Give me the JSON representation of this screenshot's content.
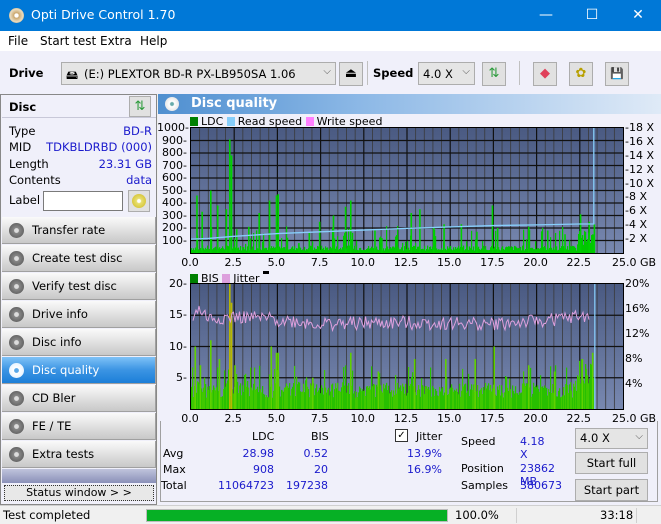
{
  "window": {
    "title": "Opti Drive Control 1.70",
    "minimize": "—",
    "maximize": "☐",
    "close": "✕"
  },
  "menu": [
    "File",
    "Start test",
    "Extra",
    "Help"
  ],
  "toolbar": {
    "drive_label": "Drive",
    "drive_value": "(E:)  PLEXTOR BD-R  PX-LB950SA 1.06",
    "speed_label": "Speed",
    "speed_value": "4.0 X",
    "eject_icon": "⏏",
    "refresh_icon": "⇅",
    "erase_icon": "◆",
    "burn_icon": "✿",
    "save_icon": "💾"
  },
  "disc": {
    "header": "Disc",
    "rows": [
      {
        "key": "Type",
        "value": "BD-R"
      },
      {
        "key": "MID",
        "value": "TDKBLDRBD (000)"
      },
      {
        "key": "Length",
        "value": "23.31 GB"
      },
      {
        "key": "Contents",
        "value": "data"
      }
    ],
    "label_key": "Label",
    "label_value": ""
  },
  "nav": [
    {
      "label": "Transfer rate",
      "active": false
    },
    {
      "label": "Create test disc",
      "active": false
    },
    {
      "label": "Verify test disc",
      "active": false
    },
    {
      "label": "Drive info",
      "active": false
    },
    {
      "label": "Disc info",
      "active": false
    },
    {
      "label": "Disc quality",
      "active": true
    },
    {
      "label": "CD Bler",
      "active": false
    },
    {
      "label": "FE / TE",
      "active": false
    },
    {
      "label": "Extra tests",
      "active": false
    }
  ],
  "status_window_btn": "Status window > >",
  "panel_title": "Disc quality",
  "chart_data": [
    {
      "type": "bar",
      "title": "LDC / Read speed",
      "legend": [
        {
          "name": "LDC",
          "color": "#008000"
        },
        {
          "name": "Read speed",
          "color": "#87cefa"
        },
        {
          "name": "Write speed",
          "color": "#ff80ff"
        }
      ],
      "xlabel": "GB",
      "xlim": [
        0,
        25
      ],
      "ylim": [
        0,
        1000
      ],
      "y2lim": [
        0,
        18
      ],
      "x_ticks": [
        "0.0",
        "2.5",
        "5.0",
        "7.5",
        "10.0",
        "12.5",
        "15.0",
        "17.5",
        "20.0",
        "22.5",
        "25.0 GB"
      ],
      "y_ticks": [
        "100",
        "200",
        "300",
        "400",
        "500",
        "600",
        "700",
        "800",
        "900",
        "1000"
      ],
      "y2_ticks": [
        "2 X",
        "4 X",
        "6 X",
        "8 X",
        "10 X",
        "12 X",
        "14 X",
        "16 X",
        "18 X"
      ],
      "grid": true,
      "data_end_gb": 23.31,
      "ldc_peaks": [
        [
          0.3,
          460
        ],
        [
          0.6,
          330
        ],
        [
          1.1,
          500
        ],
        [
          1.5,
          380
        ],
        [
          2.0,
          350
        ],
        [
          2.2,
          908
        ],
        [
          2.3,
          780
        ],
        [
          2.6,
          190
        ],
        [
          3.3,
          210
        ],
        [
          3.9,
          320
        ],
        [
          4.5,
          420
        ],
        [
          4.9,
          460
        ],
        [
          5.0,
          470
        ],
        [
          6.2,
          80
        ],
        [
          6.8,
          160
        ],
        [
          7.4,
          250
        ],
        [
          8.2,
          300
        ],
        [
          8.9,
          370
        ],
        [
          9.2,
          420
        ],
        [
          10.6,
          180
        ],
        [
          11.0,
          120
        ],
        [
          12.7,
          320
        ],
        [
          13.2,
          350
        ],
        [
          14.0,
          200
        ],
        [
          14.6,
          230
        ],
        [
          15.6,
          230
        ],
        [
          16.5,
          170
        ],
        [
          17.4,
          380
        ],
        [
          17.7,
          200
        ],
        [
          19.5,
          210
        ],
        [
          20.6,
          180
        ],
        [
          21.6,
          150
        ],
        [
          22.5,
          310
        ],
        [
          23.0,
          250
        ],
        [
          23.3,
          230
        ]
      ],
      "ldc_baseline": 40,
      "read_speed": [
        [
          0,
          2.0
        ],
        [
          1,
          2.1
        ],
        [
          2.5,
          2.4
        ],
        [
          5,
          2.8
        ],
        [
          7.5,
          3.05
        ],
        [
          10,
          3.3
        ],
        [
          12.5,
          3.55
        ],
        [
          15,
          3.75
        ],
        [
          17.5,
          3.95
        ],
        [
          20,
          4.05
        ],
        [
          22.5,
          4.18
        ],
        [
          23.31,
          4.18
        ],
        [
          23.31,
          18
        ]
      ]
    },
    {
      "type": "bar",
      "title": "BIS / Jitter",
      "legend": [
        {
          "name": "BIS",
          "color": "#008000"
        },
        {
          "name": "Jitter",
          "color": "#dda0dd"
        }
      ],
      "xlabel": "GB",
      "xlim": [
        0,
        25
      ],
      "ylim": [
        0,
        20
      ],
      "y2lim": [
        0,
        20
      ],
      "x_ticks": [
        "0.0",
        "2.5",
        "5.0",
        "7.5",
        "10.0",
        "12.5",
        "15.0",
        "17.5",
        "20.0",
        "22.5",
        "25.0 GB"
      ],
      "y_ticks": [
        "5",
        "10",
        "15",
        "20"
      ],
      "y2_ticks": [
        "4%",
        "8%",
        "12%",
        "16%",
        "20%"
      ],
      "grid": true,
      "data_end_gb": 23.31,
      "bis_peaks": [
        [
          0.2,
          10
        ],
        [
          0.5,
          7
        ],
        [
          1.1,
          11
        ],
        [
          1.6,
          8
        ],
        [
          2.2,
          20
        ],
        [
          2.3,
          17
        ],
        [
          2.5,
          7
        ],
        [
          4.6,
          10
        ],
        [
          4.9,
          9
        ],
        [
          5.0,
          9
        ],
        [
          7.0,
          5
        ],
        [
          9.2,
          9
        ],
        [
          10.8,
          6
        ],
        [
          12.9,
          8
        ],
        [
          14.7,
          8
        ],
        [
          16.4,
          8
        ],
        [
          17.5,
          10
        ],
        [
          19.5,
          7
        ],
        [
          21.0,
          6
        ],
        [
          22.6,
          8
        ],
        [
          23.2,
          9
        ]
      ],
      "bis_baseline": 3,
      "jitter_pct": [
        [
          0,
          14.5
        ],
        [
          0.5,
          16.0
        ],
        [
          1.0,
          14.5
        ],
        [
          2.5,
          14.7
        ],
        [
          5,
          14.3
        ],
        [
          7.5,
          13.6
        ],
        [
          10,
          13.7
        ],
        [
          12.5,
          13.8
        ],
        [
          15,
          13.7
        ],
        [
          17.5,
          13.6
        ],
        [
          20,
          14.0
        ],
        [
          22.5,
          14.8
        ],
        [
          23.31,
          14.8
        ]
      ]
    }
  ],
  "stats": {
    "col_ldc": "LDC",
    "col_bis": "BIS",
    "jitter_label": "Jitter",
    "jitter_checked": true,
    "rows": [
      {
        "label": "Avg",
        "ldc": "28.98",
        "bis": "0.52",
        "jitter": "13.9%"
      },
      {
        "label": "Max",
        "ldc": "908",
        "bis": "20",
        "jitter": "16.9%"
      },
      {
        "label": "Total",
        "ldc": "11064723",
        "bis": "197238",
        "jitter": ""
      }
    ],
    "speed_label": "Speed",
    "speed_value": "4.18 X",
    "position_label": "Position",
    "position_value": "23862 MB",
    "samples_label": "Samples",
    "samples_value": "380673",
    "speed_select": "4.0 X",
    "start_full": "Start full",
    "start_part": "Start part"
  },
  "statusbar": {
    "text": "Test completed",
    "progress": 100.0,
    "progress_text": "100.0%",
    "time": "33:18"
  }
}
